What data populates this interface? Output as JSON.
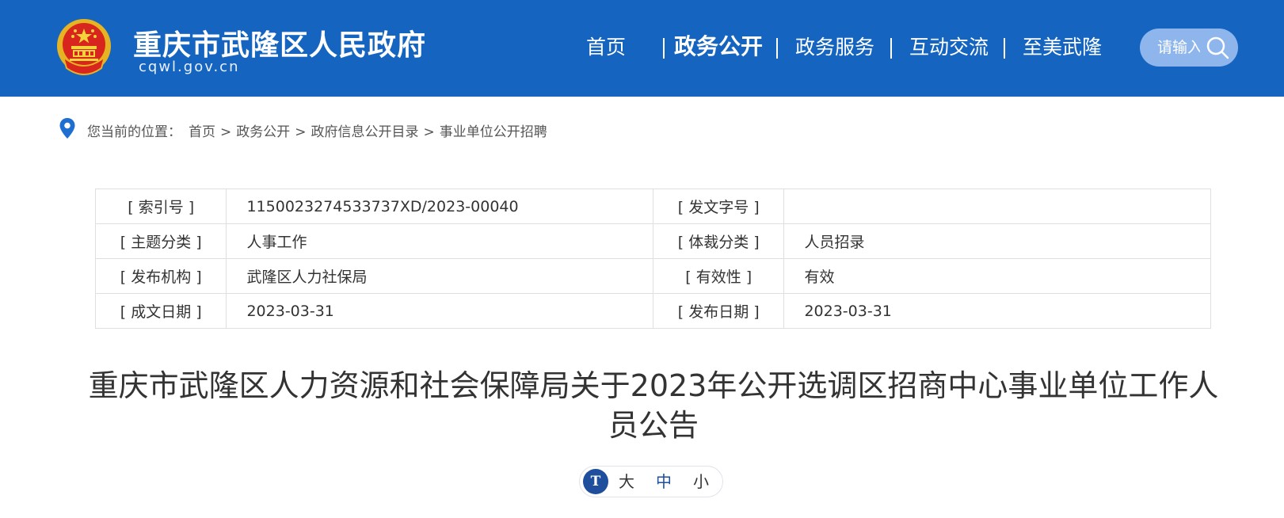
{
  "header": {
    "site_title": "重庆市武隆区人民政府",
    "site_domain": "cqwl.gov.cn",
    "nav": [
      {
        "label": "首页",
        "active": false
      },
      {
        "label": "政务公开",
        "active": true
      },
      {
        "label": "政务服务",
        "active": false
      },
      {
        "label": "互动交流",
        "active": false
      },
      {
        "label": "至美武隆",
        "active": false
      }
    ],
    "search": {
      "placeholder": "请输入"
    },
    "colors": {
      "brand": "#1565c0",
      "search_bg": "#8fb6ec"
    }
  },
  "breadcrumb": {
    "prefix": "您当前的位置：",
    "items": [
      "首页",
      "政务公开",
      "政府信息公开目录",
      "事业单位公开招聘"
    ],
    "separator": ">"
  },
  "info_table": {
    "rows": [
      {
        "label1": "[ 索引号 ]",
        "value1": "1150023274533737XD/2023-00040",
        "label2": "[ 发文字号 ]",
        "value2": ""
      },
      {
        "label1": "[ 主题分类 ]",
        "value1": "人事工作",
        "label2": "[ 体裁分类 ]",
        "value2": "人员招录"
      },
      {
        "label1": "[ 发布机构 ]",
        "value1": "武隆区人力社保局",
        "label2": "[ 有效性 ]",
        "value2": "有效"
      },
      {
        "label1": "[ 成文日期 ]",
        "value1": "2023-03-31",
        "label2": "[ 发布日期 ]",
        "value2": "2023-03-31"
      }
    ]
  },
  "article": {
    "title": "重庆市武隆区人力资源和社会保障局关于2023年公开选调区招商中心事业单位工作人员公告"
  },
  "font_size": {
    "icon_text": "T",
    "large": "大",
    "medium": "中",
    "small": "小"
  }
}
